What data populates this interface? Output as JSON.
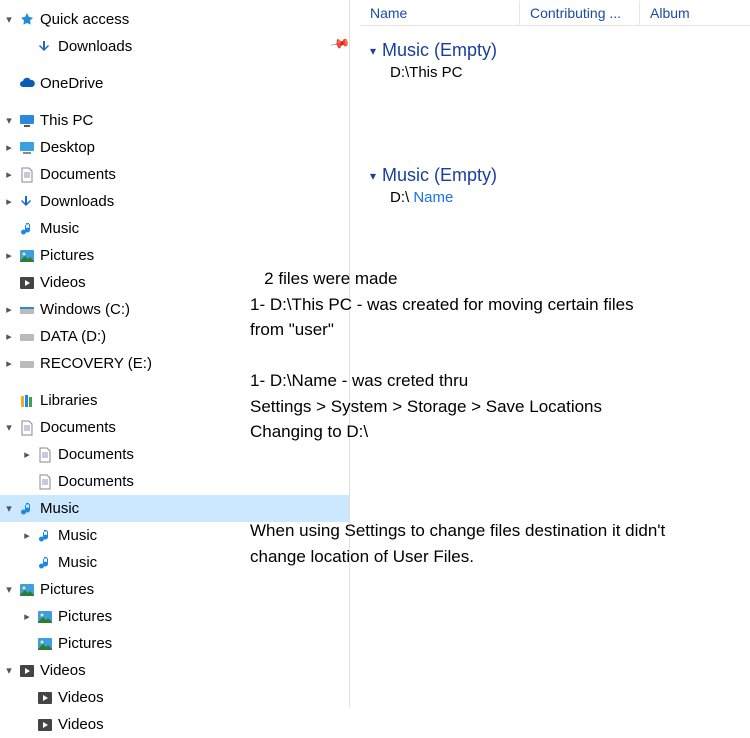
{
  "columns": {
    "name": "Name",
    "contrib": "Contributing ...",
    "album": "Album"
  },
  "pin": "📌",
  "sidebar": {
    "quick_access": "Quick access",
    "downloads_qa": "Downloads",
    "onedrive": "OneDrive",
    "this_pc": "This PC",
    "desktop": "Desktop",
    "documents": "Documents",
    "downloads": "Downloads",
    "music": "Music",
    "pictures": "Pictures",
    "videos": "Videos",
    "windows_c": "Windows (C:)",
    "data_d": "DATA (D:)",
    "recovery_e": "RECOVERY (E:)",
    "libraries": "Libraries",
    "lib_documents": "Documents",
    "lib_documents_1": "Documents",
    "lib_documents_2": "Documents",
    "lib_music": "Music",
    "lib_music_1": "Music",
    "lib_music_2": "Music",
    "lib_pictures": "Pictures",
    "lib_pictures_1": "Pictures",
    "lib_pictures_2": "Pictures",
    "lib_videos": "Videos",
    "lib_videos_1": "Videos",
    "lib_videos_2": "Videos"
  },
  "groups": {
    "g1": {
      "title": "Music (Empty)",
      "sub": "D:\\This PC"
    },
    "g2": {
      "title": "Music (Empty)",
      "sub_prefix": "D:\\ ",
      "sub_link": "Name"
    }
  },
  "annot": {
    "a1_l1": "   2 files were made",
    "a1_l2": "1- D:\\This PC - was created for moving certain files from  \"user\"",
    "a2_l1": "1- D:\\Name - was creted thru",
    "a2_l2": "Settings > System > Storage > Save Locations Changing to D:\\",
    "a3": "When using Settings to change files destination it didn't change location of User Files."
  }
}
